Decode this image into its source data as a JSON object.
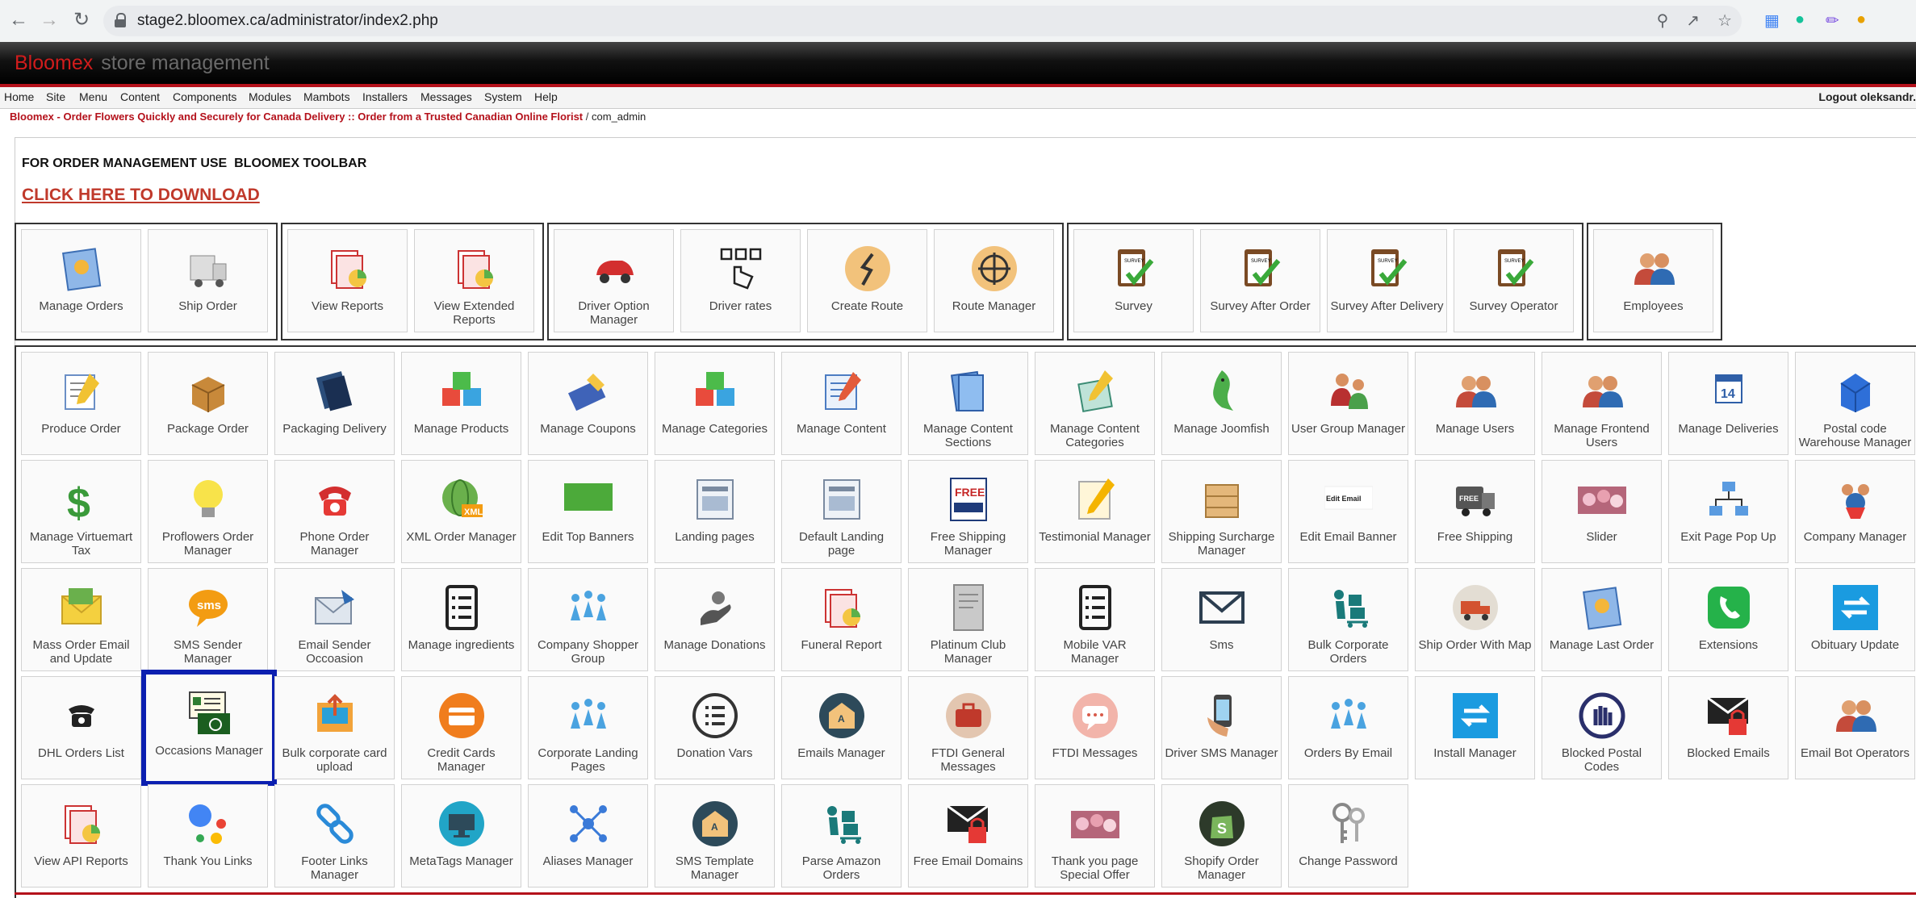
{
  "browser": {
    "url": "stage2.bloomex.ca/administrator/index2.php",
    "back_icon": "back-arrow-icon",
    "forward_icon": "forward-arrow-icon",
    "reload_icon": "reload-icon"
  },
  "header": {
    "brand": "Bloomex",
    "title": "store management"
  },
  "menu": {
    "items": [
      "Home",
      "Site",
      "Menu",
      "Content",
      "Components",
      "Modules",
      "Mambots",
      "Installers",
      "Messages",
      "System",
      "Help"
    ],
    "logout": "Logout oleksandr."
  },
  "breadcrumb": {
    "site": "Bloomex - Order Flowers Quickly and Securely for Canada Delivery :: Order from a Trusted Canadian Online Florist",
    "separator": "/",
    "current": "com_admin"
  },
  "toolbar_note": "FOR ORDER MANAGEMENT USE  BLOOMEX TOOLBAR",
  "download_link": "CLICK HERE TO DOWNLOAD",
  "groups": [
    {
      "items": [
        {
          "label": "Manage Orders",
          "icon": "orders-icon"
        },
        {
          "label": "Ship Order",
          "icon": "truck-icon"
        }
      ]
    },
    {
      "items": [
        {
          "label": "View Reports",
          "icon": "reports-icon"
        },
        {
          "label": "View Extended Reports",
          "icon": "reports-icon"
        }
      ]
    },
    {
      "items": [
        {
          "label": "Driver Option Manager",
          "icon": "car-icon"
        },
        {
          "label": "Driver rates",
          "icon": "hand-tap-icon"
        },
        {
          "label": "Create Route",
          "icon": "route-icon"
        },
        {
          "label": "Route Manager",
          "icon": "target-icon"
        }
      ]
    },
    {
      "items": [
        {
          "label": "Survey",
          "icon": "survey-icon"
        },
        {
          "label": "Survey After Order",
          "icon": "survey-icon"
        },
        {
          "label": "Survey After Delivery",
          "icon": "survey-icon"
        },
        {
          "label": "Survey Operator",
          "icon": "survey-icon"
        }
      ]
    },
    {
      "items": [
        {
          "label": "Employees",
          "icon": "users-icon"
        }
      ]
    }
  ],
  "tiles": [
    [
      {
        "label": "Produce Order",
        "icon": "produce-order-icon"
      },
      {
        "label": "Package Order",
        "icon": "package-icon"
      },
      {
        "label": "Packaging Delivery",
        "icon": "books-icon"
      },
      {
        "label": "Manage Products",
        "icon": "cubes-icon"
      },
      {
        "label": "Manage Coupons",
        "icon": "coupons-icon"
      },
      {
        "label": "Manage Categories",
        "icon": "cubes-icon"
      },
      {
        "label": "Manage Content",
        "icon": "content-icon"
      },
      {
        "label": "Manage Content Sections",
        "icon": "sections-icon"
      },
      {
        "label": "Manage Content Categories",
        "icon": "content-categories-icon"
      },
      {
        "label": "Manage Joomfish",
        "icon": "fish-icon"
      },
      {
        "label": "User Group Manager",
        "icon": "user-group-icon"
      },
      {
        "label": "Manage Users",
        "icon": "users-icon"
      },
      {
        "label": "Manage Frontend Users",
        "icon": "users-icon"
      },
      {
        "label": "Manage Deliveries",
        "icon": "calendar-icon"
      },
      {
        "label": "Postal code Warehouse Manager",
        "icon": "warehouse-icon"
      }
    ],
    [
      {
        "label": "Manage Virtuemart Tax",
        "icon": "dollar-icon"
      },
      {
        "label": "Proflowers Order Manager",
        "icon": "lightbulb-icon"
      },
      {
        "label": "Phone Order Manager",
        "icon": "phone-icon"
      },
      {
        "label": "XML Order Manager",
        "icon": "xml-globe-icon"
      },
      {
        "label": "Edit Top Banners",
        "icon": "banner-icon"
      },
      {
        "label": "Landing pages",
        "icon": "landing-page-icon"
      },
      {
        "label": "Default Landing page",
        "icon": "landing-page-icon"
      },
      {
        "label": "Free Shipping Manager",
        "icon": "free-shipping-icon"
      },
      {
        "label": "Testimonial Manager",
        "icon": "testimonial-icon"
      },
      {
        "label": "Shipping Surcharge Manager",
        "icon": "box-icon"
      },
      {
        "label": "Edit Email Banner",
        "icon": "email-banner-icon"
      },
      {
        "label": "Free Shipping",
        "icon": "free-truck-icon"
      },
      {
        "label": "Slider",
        "icon": "slider-icon"
      },
      {
        "label": "Exit Page Pop Up",
        "icon": "network-icon"
      },
      {
        "label": "Company Manager",
        "icon": "company-icon"
      }
    ],
    [
      {
        "label": "Mass Order Email and Update",
        "icon": "mail-icon"
      },
      {
        "label": "SMS Sender Manager",
        "icon": "sms-icon"
      },
      {
        "label": "Email Sender Occoasion",
        "icon": "email-sender-icon"
      },
      {
        "label": "Manage ingredients",
        "icon": "list-icon"
      },
      {
        "label": "Company Shopper Group",
        "icon": "people-group-icon"
      },
      {
        "label": "Manage Donations",
        "icon": "donation-icon"
      },
      {
        "label": "Funeral Report",
        "icon": "reports-icon"
      },
      {
        "label": "Platinum Club Manager",
        "icon": "platinum-card-icon"
      },
      {
        "label": "Mobile VAR Manager",
        "icon": "list-icon"
      },
      {
        "label": "Sms",
        "icon": "envelope-icon"
      },
      {
        "label": "Bulk Corporate Orders",
        "icon": "dolly-icon"
      },
      {
        "label": "Ship Order With Map",
        "icon": "ship-map-icon"
      },
      {
        "label": "Manage Last Order",
        "icon": "orders-icon"
      },
      {
        "label": "Extensions",
        "icon": "phone-green-icon"
      },
      {
        "label": "Obituary Update",
        "icon": "update-arrows-icon"
      }
    ],
    [
      {
        "label": "DHL Orders List",
        "icon": "telephone-icon"
      },
      {
        "label": "Occasions Manager",
        "icon": "occasions-icon",
        "selected": true
      },
      {
        "label": "Bulk corporate card upload",
        "icon": "card-upload-icon"
      },
      {
        "label": "Credit Cards Manager",
        "icon": "credit-card-icon"
      },
      {
        "label": "Corporate Landing Pages",
        "icon": "people-group-icon"
      },
      {
        "label": "Donation Vars",
        "icon": "list-circle-icon"
      },
      {
        "label": "Emails Manager",
        "icon": "email-open-icon"
      },
      {
        "label": "FTDI General Messages",
        "icon": "briefcase-icon"
      },
      {
        "label": "FTDI Messages",
        "icon": "chat-icon"
      },
      {
        "label": "Driver SMS Manager",
        "icon": "phone-hand-icon"
      },
      {
        "label": "Orders By Email",
        "icon": "people-group-icon"
      },
      {
        "label": "Install Manager",
        "icon": "update-arrows-icon"
      },
      {
        "label": "Blocked Postal Codes",
        "icon": "blocked-hand-icon"
      },
      {
        "label": "Blocked Emails",
        "icon": "locked-mail-icon"
      },
      {
        "label": "Email Bot Operators",
        "icon": "users-icon"
      }
    ],
    [
      {
        "label": "View API Reports",
        "icon": "reports-icon"
      },
      {
        "label": "Thank You Links",
        "icon": "dots-icon"
      },
      {
        "label": "Footer Links Manager",
        "icon": "link-icon"
      },
      {
        "label": "MetaTags Manager",
        "icon": "monitor-icon"
      },
      {
        "label": "Aliases Manager",
        "icon": "network-nodes-icon"
      },
      {
        "label": "SMS Template Manager",
        "icon": "email-open-icon"
      },
      {
        "label": "Parse Amazon Orders",
        "icon": "dolly-icon"
      },
      {
        "label": "Free Email Domains",
        "icon": "locked-mail-icon"
      },
      {
        "label": "Thank you page Special Offer",
        "icon": "slider-icon"
      },
      {
        "label": "Shopify Order Manager",
        "icon": "shopify-icon"
      },
      {
        "label": "Change Password",
        "icon": "keys-icon"
      }
    ]
  ],
  "colors": {
    "accent_red": "#b4111b",
    "brand_red": "#d11c1c",
    "selected_border": "#0b1fb0",
    "link_red": "#c0392b"
  }
}
